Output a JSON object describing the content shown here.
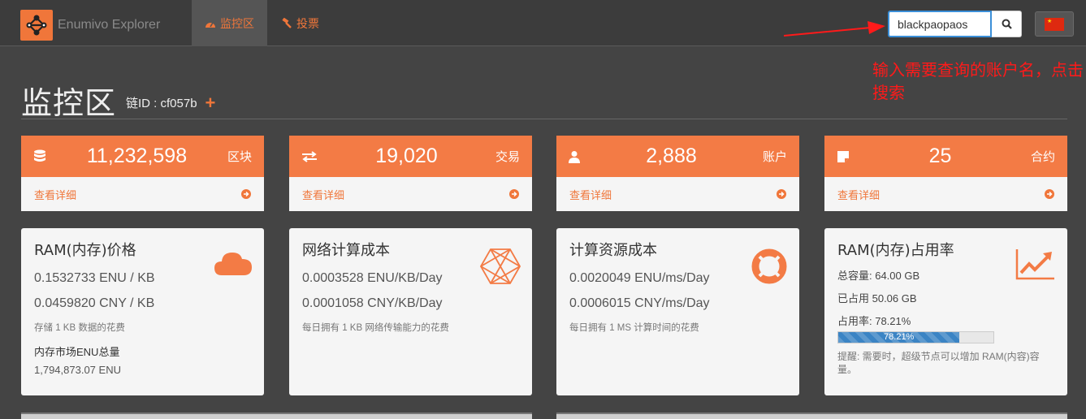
{
  "brand": {
    "name": "Enumivo Explorer",
    "logo_icon": "network-nodes-icon"
  },
  "nav": [
    {
      "label": "监控区",
      "icon": "dashboard-icon",
      "active": true
    },
    {
      "label": "投票",
      "icon": "gavel-icon",
      "active": false
    }
  ],
  "search": {
    "value": "blackpaopaos",
    "button_icon": "search-icon"
  },
  "language": {
    "flag": "cn-flag-icon"
  },
  "annotation": {
    "text": "输入需要查询的账户名，点击搜索",
    "color": "#ff1a1a"
  },
  "page": {
    "title": "监控区",
    "chain_label": "链ID : cf057b",
    "chain_plus": "+"
  },
  "stats": [
    {
      "icon": "database-icon",
      "value": "11,232,598",
      "label": "区块",
      "link": "查看详细"
    },
    {
      "icon": "exchange-icon",
      "value": "19,020",
      "label": "交易",
      "link": "查看详细"
    },
    {
      "icon": "user-icon",
      "value": "2,888",
      "label": "账户",
      "link": "查看详细"
    },
    {
      "icon": "note-icon",
      "value": "25",
      "label": "合约",
      "link": "查看详细"
    }
  ],
  "cards": {
    "ram_price": {
      "title": "RAM(内存)价格",
      "enu": "0.1532733 ENU / KB",
      "cny": "0.0459820 CNY / KB",
      "note": "存储 1 KB 数据的花费",
      "market_label": "内存市场ENU总量",
      "market_value": "1,794,873.07 ENU",
      "icon": "cloud-icon"
    },
    "net_cost": {
      "title": "网络计算成本",
      "enu": "0.0003528 ENU/KB/Day",
      "cny": "0.0001058 CNY/KB/Day",
      "note": "每日拥有 1 KB 网络传输能力的花费",
      "icon": "network-hexagon-icon"
    },
    "cpu_cost": {
      "title": "计算资源成本",
      "enu": "0.0020049 ENU/ms/Day",
      "cny": "0.0006015 CNY/ms/Day",
      "note": "每日拥有 1 MS 计算时间的花费",
      "icon": "life-ring-icon"
    },
    "ram_usage": {
      "title": "RAM(内存)占用率",
      "total": "总容量: 64.00 GB",
      "used": "已占用 50.06 GB",
      "rate": "占用率: 78.21%",
      "progress_label": "78.21%",
      "progress_fraction": 0.7821,
      "note": "提醒: 需要时，超级节点可以增加 RAM(内容)容量。",
      "icon": "line-chart-icon"
    }
  },
  "colors": {
    "accent": "#f37b45",
    "background": "#444444",
    "progress": "#3b84c4"
  }
}
